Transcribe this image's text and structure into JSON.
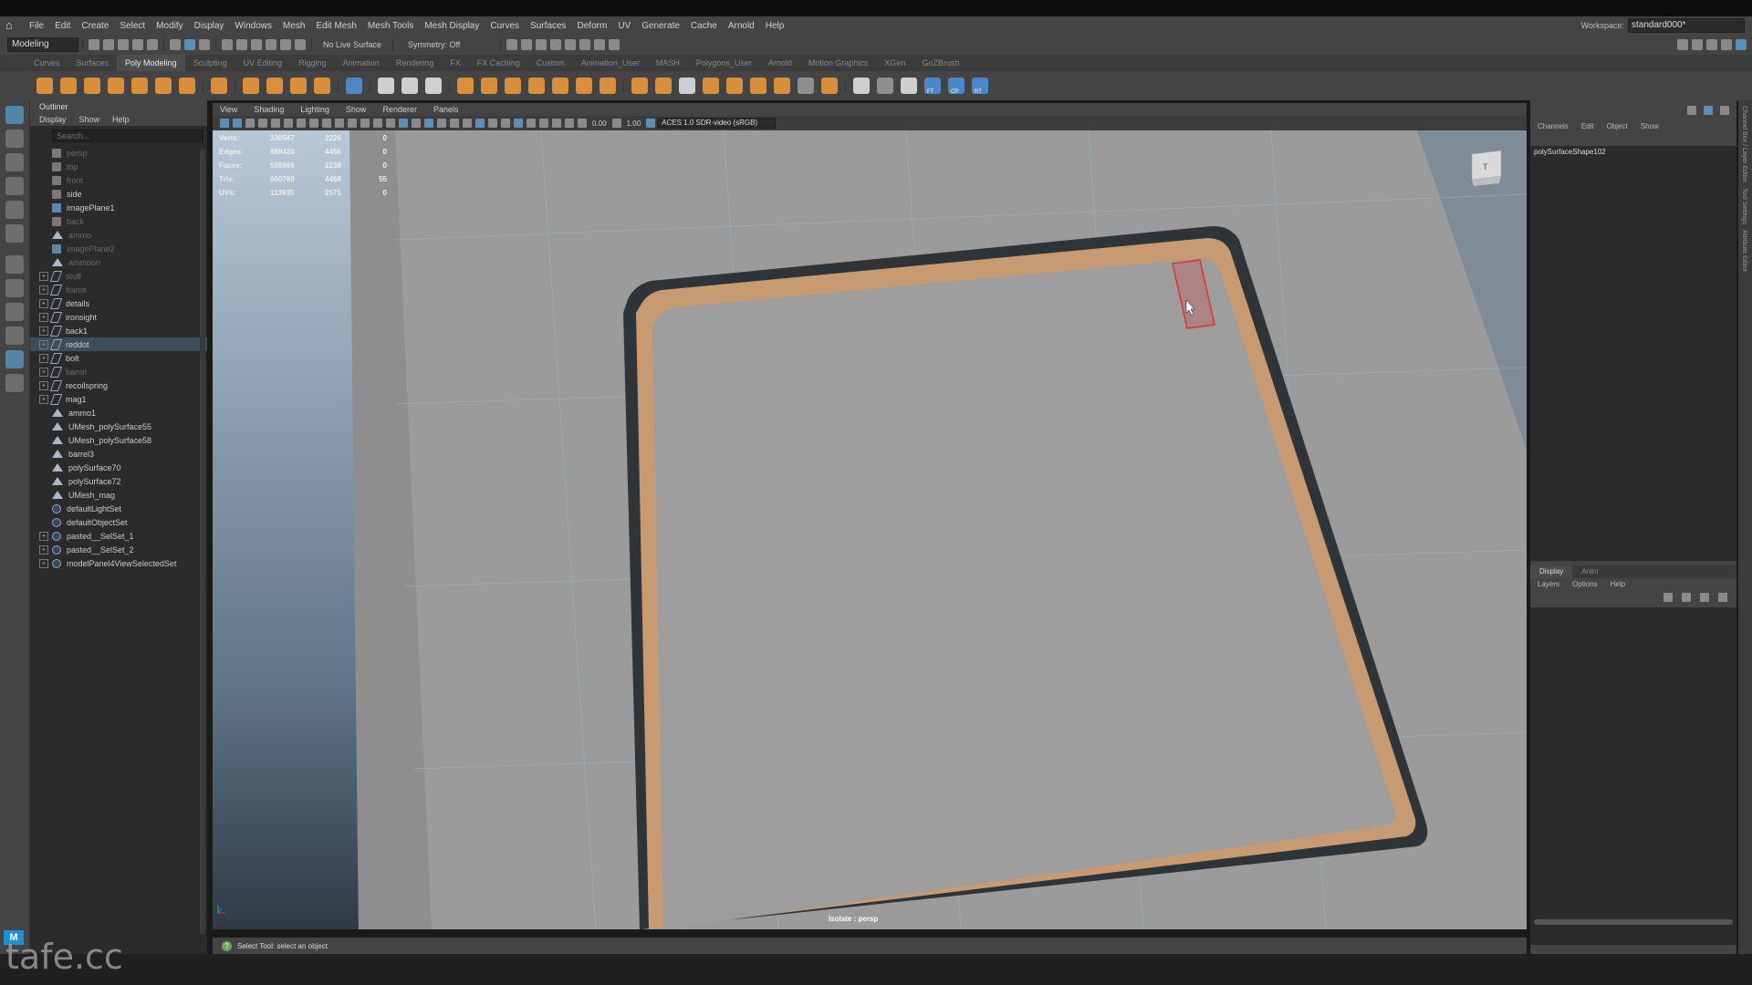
{
  "menubar": {
    "items": [
      "File",
      "Edit",
      "Create",
      "Select",
      "Modify",
      "Display",
      "Windows",
      "Mesh",
      "Edit Mesh",
      "Mesh Tools",
      "Mesh Display",
      "Curves",
      "Surfaces",
      "Deform",
      "UV",
      "Generate",
      "Cache",
      "Arnold",
      "Help"
    ],
    "workspace_label": "Workspace:",
    "workspace_value": "standard000*"
  },
  "statusline": {
    "mode": "Modeling",
    "live_surface": "No Live Surface",
    "symmetry": "Symmetry: Off"
  },
  "shelf": {
    "tabs": [
      "Curves",
      "Surfaces",
      "Poly Modeling",
      "Sculpting",
      "UV Editing",
      "Rigging",
      "Animation",
      "Rendering",
      "FX",
      "FX Caching",
      "Custom",
      "Animation_User",
      "MASH",
      "Polygons_User",
      "Arnold",
      "Motion Graphics",
      "XGen",
      "GoZBrush"
    ],
    "active_tab": "Poly Modeling",
    "icon_labels": [
      "FT",
      "CP",
      "RT"
    ]
  },
  "outliner": {
    "title": "Outliner",
    "menu": [
      "Display",
      "Show",
      "Help"
    ],
    "search_placeholder": "Search...",
    "items": [
      {
        "label": "persp",
        "icon": "camera-icon",
        "dim": true,
        "expand": false
      },
      {
        "label": "top",
        "icon": "camera-icon",
        "dim": true,
        "expand": false
      },
      {
        "label": "front",
        "icon": "camera-icon",
        "dim": true,
        "expand": false
      },
      {
        "label": "side",
        "icon": "camera-icon",
        "dim": false,
        "expand": false
      },
      {
        "label": "imagePlane1",
        "icon": "image-plane-icon",
        "dim": false,
        "expand": false
      },
      {
        "label": "back",
        "icon": "camera-icon",
        "dim": true,
        "expand": false
      },
      {
        "label": "ammo",
        "icon": "mesh-icon",
        "dim": true,
        "expand": false
      },
      {
        "label": "imagePlane2",
        "icon": "image-plane-icon",
        "dim": true,
        "expand": false
      },
      {
        "label": "ammoori",
        "icon": "mesh-icon",
        "dim": true,
        "expand": false
      },
      {
        "label": "stuff",
        "icon": "group-icon",
        "dim": true,
        "expand": true
      },
      {
        "label": "frame",
        "icon": "group-icon",
        "dim": true,
        "expand": true
      },
      {
        "label": "details",
        "icon": "group-icon",
        "dim": false,
        "expand": true
      },
      {
        "label": "ironsight",
        "icon": "group-icon",
        "dim": false,
        "expand": true
      },
      {
        "label": "back1",
        "icon": "group-icon",
        "dim": false,
        "expand": true
      },
      {
        "label": "reddot",
        "icon": "group-icon",
        "dim": false,
        "expand": true,
        "selected": true
      },
      {
        "label": "bolt",
        "icon": "group-icon",
        "dim": false,
        "expand": true
      },
      {
        "label": "barrel",
        "icon": "group-icon",
        "dim": true,
        "expand": true
      },
      {
        "label": "recoilspring",
        "icon": "group-icon",
        "dim": false,
        "expand": true
      },
      {
        "label": "mag1",
        "icon": "group-icon",
        "dim": false,
        "expand": true
      },
      {
        "label": "ammo1",
        "icon": "mesh-icon",
        "dim": false,
        "expand": false
      },
      {
        "label": "UMesh_polySurface55",
        "icon": "mesh-icon",
        "dim": false,
        "expand": false
      },
      {
        "label": "UMesh_polySurface58",
        "icon": "mesh-icon",
        "dim": false,
        "expand": false
      },
      {
        "label": "barrel3",
        "icon": "mesh-icon",
        "dim": false,
        "expand": false
      },
      {
        "label": "polySurface70",
        "icon": "mesh-icon",
        "dim": false,
        "expand": false
      },
      {
        "label": "polySurface72",
        "icon": "mesh-icon",
        "dim": false,
        "expand": false
      },
      {
        "label": "UMesh_mag",
        "icon": "mesh-icon",
        "dim": false,
        "expand": false
      },
      {
        "label": "defaultLightSet",
        "icon": "set-icon",
        "dim": false,
        "expand": false
      },
      {
        "label": "defaultObjectSet",
        "icon": "set-icon",
        "dim": false,
        "expand": false
      },
      {
        "label": "pasted__SelSet_1",
        "icon": "set-icon",
        "dim": false,
        "expand": true
      },
      {
        "label": "pasted__SelSet_2",
        "icon": "set-icon",
        "dim": false,
        "expand": true
      },
      {
        "label": "modelPanel4ViewSelectedSet",
        "icon": "set-icon",
        "dim": false,
        "expand": true
      }
    ]
  },
  "viewport": {
    "menu": [
      "View",
      "Shading",
      "Lighting",
      "Show",
      "Renderer",
      "Panels"
    ],
    "exposure": "0.00",
    "gamma": "1.00",
    "color_space": "ACES 1.0 SDR-video (sRGB)",
    "hud": [
      {
        "label": "Verts:",
        "a": "330547",
        "b": "2226",
        "c": "0"
      },
      {
        "label": "Edges:",
        "a": "889426",
        "b": "4456",
        "c": "0"
      },
      {
        "label": "Faces:",
        "a": "558966",
        "b": "2238",
        "c": "0"
      },
      {
        "label": "Tris:",
        "a": "660780",
        "b": "4468",
        "c": "55"
      },
      {
        "label": "UVs:",
        "a": "113935",
        "b": "2571",
        "c": "0"
      }
    ],
    "camera_label": "Isolate : persp"
  },
  "channelbox": {
    "menu": [
      "Channels",
      "Edit",
      "Object",
      "Show"
    ],
    "object_name": "polySurfaceShape102"
  },
  "layer_editor": {
    "tabs": [
      "Display",
      "Anim"
    ],
    "active_tab": "Display",
    "menu": [
      "Layers",
      "Options",
      "Help"
    ]
  },
  "side_tabs": [
    "Channel Box / Layer Editor",
    "Tool Settings",
    "Attribute Editor"
  ],
  "helpline": {
    "text": "Select Tool: select an object"
  },
  "watermark": "tafe.cc",
  "colors": {
    "ui_bg": "#444444",
    "panel_bg": "#2b2b2b",
    "viewport_bg": "#9a9a9a",
    "accent_blue": "#5285a6",
    "selection_red": "#e03030",
    "highlight_orange": "#d98e3c"
  }
}
